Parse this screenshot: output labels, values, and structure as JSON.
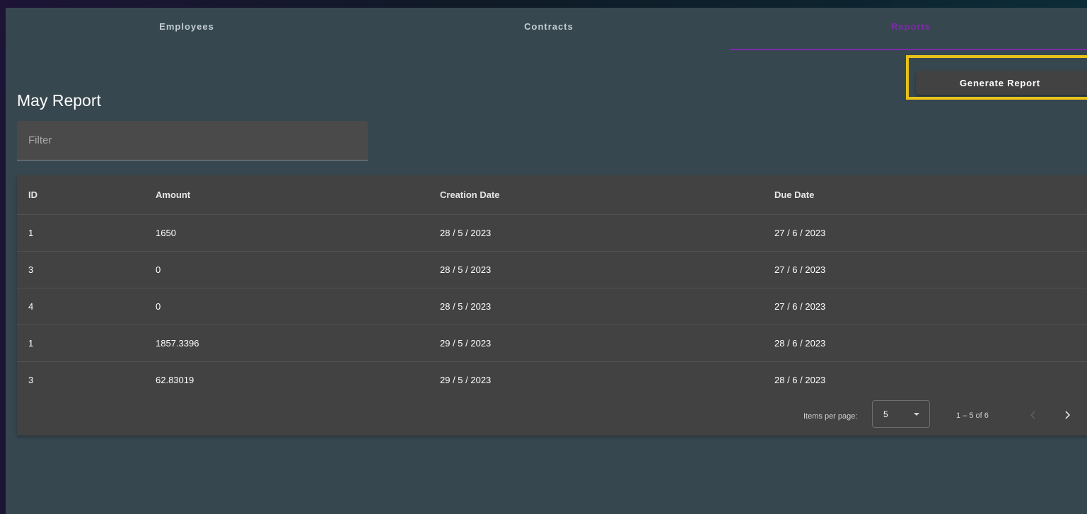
{
  "tabs": [
    {
      "label": "Employees",
      "active": false
    },
    {
      "label": "Contracts",
      "active": false
    },
    {
      "label": "Reports",
      "active": true
    }
  ],
  "toolbar": {
    "generate_label": "Generate Report",
    "highlight_color": "#e8c21a"
  },
  "page": {
    "title": "May Report"
  },
  "filter": {
    "placeholder": "Filter",
    "value": ""
  },
  "table": {
    "columns": [
      "ID",
      "Amount",
      "Creation Date",
      "Due Date"
    ],
    "rows": [
      {
        "id": "1",
        "amount": "1650",
        "creation_date": "28 / 5 / 2023",
        "due_date": "27 / 6 / 2023"
      },
      {
        "id": "3",
        "amount": "0",
        "creation_date": "28 / 5 / 2023",
        "due_date": "27 / 6 / 2023"
      },
      {
        "id": "4",
        "amount": "0",
        "creation_date": "28 / 5 / 2023",
        "due_date": "27 / 6 / 2023"
      },
      {
        "id": "1",
        "amount": "1857.3396",
        "creation_date": "29 / 5 / 2023",
        "due_date": "28 / 6 / 2023"
      },
      {
        "id": "3",
        "amount": "62.83019",
        "creation_date": "29 / 5 / 2023",
        "due_date": "28 / 6 / 2023"
      }
    ]
  },
  "paginator": {
    "items_per_page_label": "Items per page:",
    "page_size": "5",
    "range_label": "1 – 5 of 6",
    "prev_icon": "chevron-left-icon",
    "next_icon": "chevron-right-icon"
  },
  "colors": {
    "accent": "#7b2ba8",
    "surface": "#424242",
    "background": "#37474f"
  }
}
